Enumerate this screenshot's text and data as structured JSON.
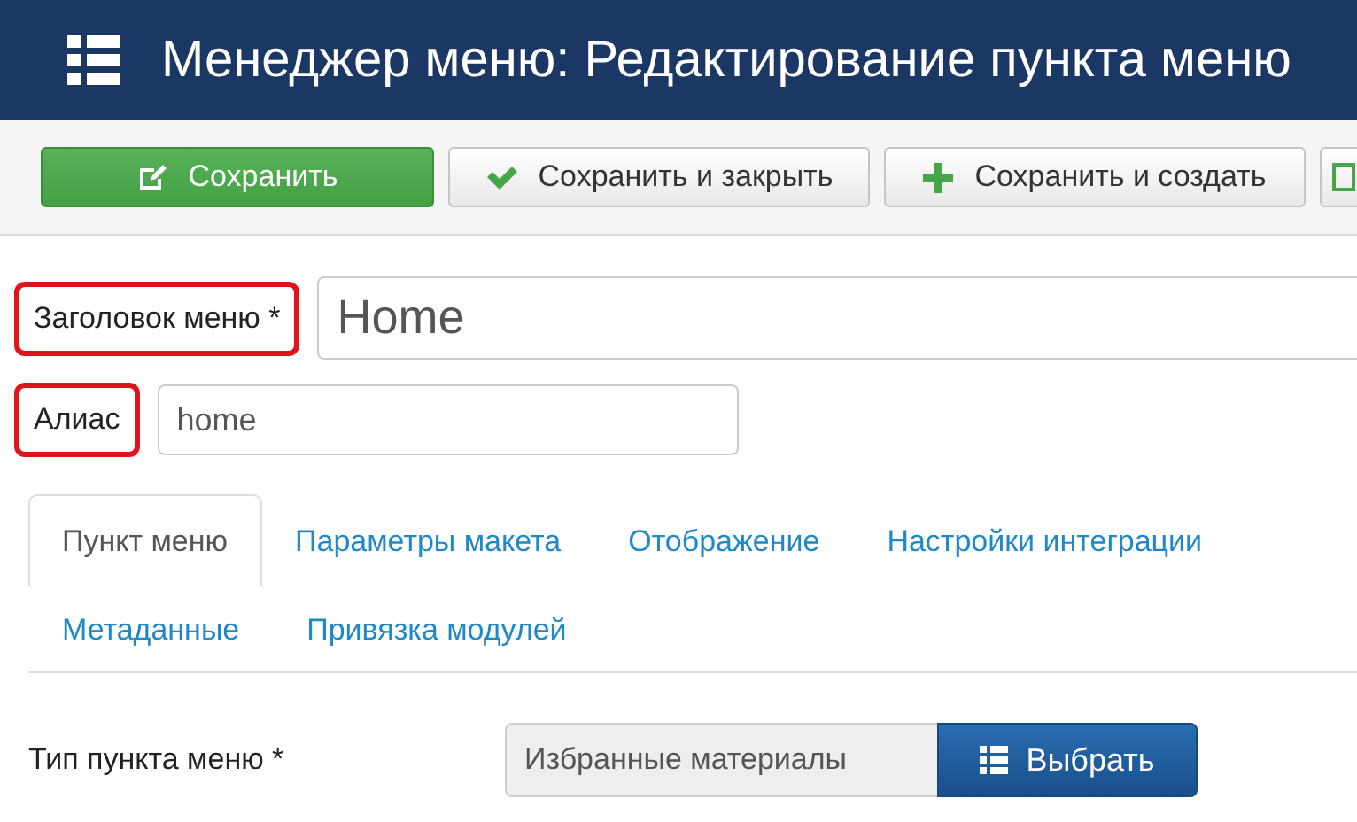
{
  "header": {
    "title": "Менеджер меню: Редактирование пункта меню"
  },
  "toolbar": [
    {
      "kind": "save",
      "label": "Сохранить"
    },
    {
      "kind": "check",
      "label": "Сохранить и закрыть"
    },
    {
      "kind": "plus",
      "label": "Сохранить и создать"
    },
    {
      "kind": "copy"
    }
  ],
  "fields": [
    {
      "kind": "large",
      "label": "Заголовок меню *",
      "value": "Home",
      "highlighted": true
    },
    {
      "kind": "small",
      "label": "Алиас",
      "value": "home",
      "highlighted": true
    }
  ],
  "tabs": [
    [
      {
        "label": "Пункт меню",
        "selected": true
      },
      {
        "label": "Параметры макета",
        "selected": false
      },
      {
        "label": "Отображение",
        "selected": false
      },
      {
        "label": "Настройки интеграции",
        "selected": false
      }
    ],
    [
      {
        "label": "Метаданные",
        "selected": false
      },
      {
        "label": "Привязка модулей",
        "selected": false
      }
    ]
  ],
  "menu_type": {
    "label": "Тип пункта меню *",
    "value": "Избранные материалы",
    "button": "Выбрать"
  }
}
